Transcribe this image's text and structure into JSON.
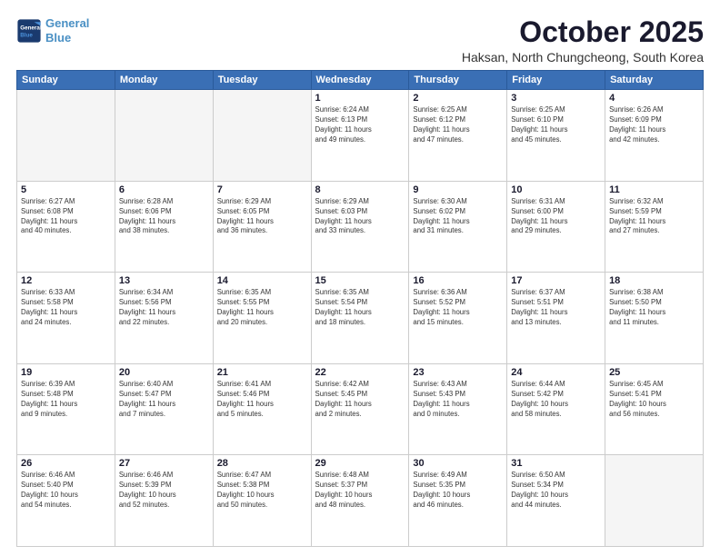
{
  "logo": {
    "line1": "General",
    "line2": "Blue"
  },
  "header": {
    "title": "October 2025",
    "subtitle": "Haksan, North Chungcheong, South Korea"
  },
  "weekdays": [
    "Sunday",
    "Monday",
    "Tuesday",
    "Wednesday",
    "Thursday",
    "Friday",
    "Saturday"
  ],
  "weeks": [
    [
      {
        "day": "",
        "info": ""
      },
      {
        "day": "",
        "info": ""
      },
      {
        "day": "",
        "info": ""
      },
      {
        "day": "1",
        "info": "Sunrise: 6:24 AM\nSunset: 6:13 PM\nDaylight: 11 hours\nand 49 minutes."
      },
      {
        "day": "2",
        "info": "Sunrise: 6:25 AM\nSunset: 6:12 PM\nDaylight: 11 hours\nand 47 minutes."
      },
      {
        "day": "3",
        "info": "Sunrise: 6:25 AM\nSunset: 6:10 PM\nDaylight: 11 hours\nand 45 minutes."
      },
      {
        "day": "4",
        "info": "Sunrise: 6:26 AM\nSunset: 6:09 PM\nDaylight: 11 hours\nand 42 minutes."
      }
    ],
    [
      {
        "day": "5",
        "info": "Sunrise: 6:27 AM\nSunset: 6:08 PM\nDaylight: 11 hours\nand 40 minutes."
      },
      {
        "day": "6",
        "info": "Sunrise: 6:28 AM\nSunset: 6:06 PM\nDaylight: 11 hours\nand 38 minutes."
      },
      {
        "day": "7",
        "info": "Sunrise: 6:29 AM\nSunset: 6:05 PM\nDaylight: 11 hours\nand 36 minutes."
      },
      {
        "day": "8",
        "info": "Sunrise: 6:29 AM\nSunset: 6:03 PM\nDaylight: 11 hours\nand 33 minutes."
      },
      {
        "day": "9",
        "info": "Sunrise: 6:30 AM\nSunset: 6:02 PM\nDaylight: 11 hours\nand 31 minutes."
      },
      {
        "day": "10",
        "info": "Sunrise: 6:31 AM\nSunset: 6:00 PM\nDaylight: 11 hours\nand 29 minutes."
      },
      {
        "day": "11",
        "info": "Sunrise: 6:32 AM\nSunset: 5:59 PM\nDaylight: 11 hours\nand 27 minutes."
      }
    ],
    [
      {
        "day": "12",
        "info": "Sunrise: 6:33 AM\nSunset: 5:58 PM\nDaylight: 11 hours\nand 24 minutes."
      },
      {
        "day": "13",
        "info": "Sunrise: 6:34 AM\nSunset: 5:56 PM\nDaylight: 11 hours\nand 22 minutes."
      },
      {
        "day": "14",
        "info": "Sunrise: 6:35 AM\nSunset: 5:55 PM\nDaylight: 11 hours\nand 20 minutes."
      },
      {
        "day": "15",
        "info": "Sunrise: 6:35 AM\nSunset: 5:54 PM\nDaylight: 11 hours\nand 18 minutes."
      },
      {
        "day": "16",
        "info": "Sunrise: 6:36 AM\nSunset: 5:52 PM\nDaylight: 11 hours\nand 15 minutes."
      },
      {
        "day": "17",
        "info": "Sunrise: 6:37 AM\nSunset: 5:51 PM\nDaylight: 11 hours\nand 13 minutes."
      },
      {
        "day": "18",
        "info": "Sunrise: 6:38 AM\nSunset: 5:50 PM\nDaylight: 11 hours\nand 11 minutes."
      }
    ],
    [
      {
        "day": "19",
        "info": "Sunrise: 6:39 AM\nSunset: 5:48 PM\nDaylight: 11 hours\nand 9 minutes."
      },
      {
        "day": "20",
        "info": "Sunrise: 6:40 AM\nSunset: 5:47 PM\nDaylight: 11 hours\nand 7 minutes."
      },
      {
        "day": "21",
        "info": "Sunrise: 6:41 AM\nSunset: 5:46 PM\nDaylight: 11 hours\nand 5 minutes."
      },
      {
        "day": "22",
        "info": "Sunrise: 6:42 AM\nSunset: 5:45 PM\nDaylight: 11 hours\nand 2 minutes."
      },
      {
        "day": "23",
        "info": "Sunrise: 6:43 AM\nSunset: 5:43 PM\nDaylight: 11 hours\nand 0 minutes."
      },
      {
        "day": "24",
        "info": "Sunrise: 6:44 AM\nSunset: 5:42 PM\nDaylight: 10 hours\nand 58 minutes."
      },
      {
        "day": "25",
        "info": "Sunrise: 6:45 AM\nSunset: 5:41 PM\nDaylight: 10 hours\nand 56 minutes."
      }
    ],
    [
      {
        "day": "26",
        "info": "Sunrise: 6:46 AM\nSunset: 5:40 PM\nDaylight: 10 hours\nand 54 minutes."
      },
      {
        "day": "27",
        "info": "Sunrise: 6:46 AM\nSunset: 5:39 PM\nDaylight: 10 hours\nand 52 minutes."
      },
      {
        "day": "28",
        "info": "Sunrise: 6:47 AM\nSunset: 5:38 PM\nDaylight: 10 hours\nand 50 minutes."
      },
      {
        "day": "29",
        "info": "Sunrise: 6:48 AM\nSunset: 5:37 PM\nDaylight: 10 hours\nand 48 minutes."
      },
      {
        "day": "30",
        "info": "Sunrise: 6:49 AM\nSunset: 5:35 PM\nDaylight: 10 hours\nand 46 minutes."
      },
      {
        "day": "31",
        "info": "Sunrise: 6:50 AM\nSunset: 5:34 PM\nDaylight: 10 hours\nand 44 minutes."
      },
      {
        "day": "",
        "info": ""
      }
    ]
  ]
}
